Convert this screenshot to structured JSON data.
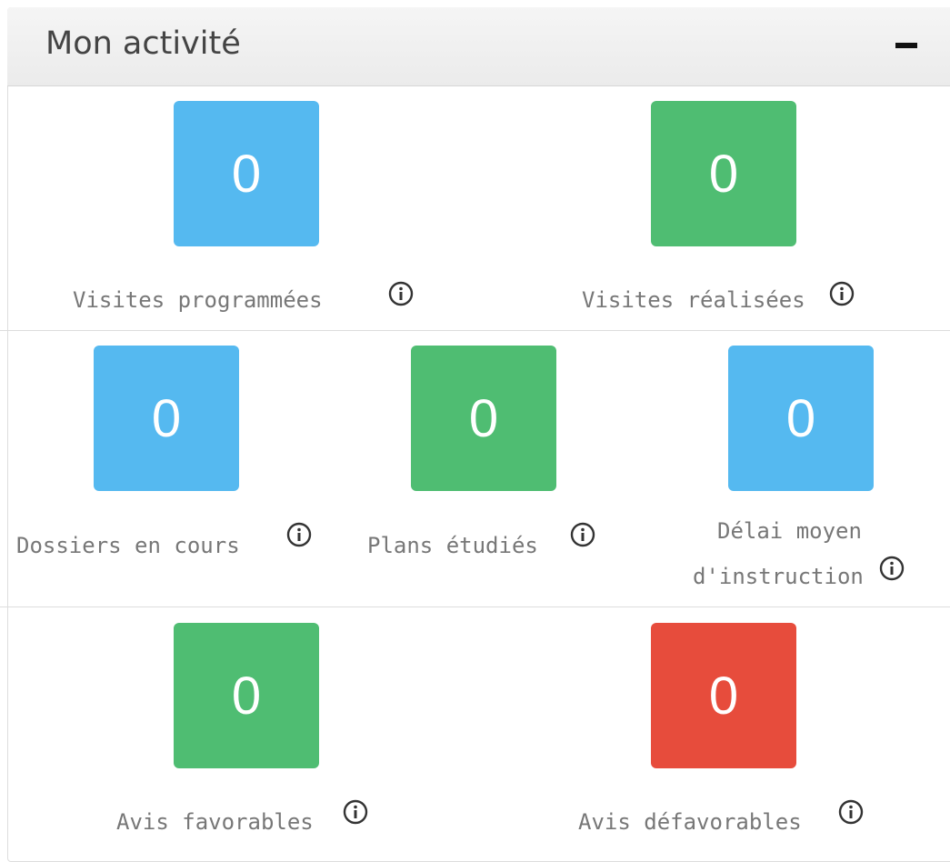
{
  "panel": {
    "title": "Mon activité",
    "collapse_icon": "minus-icon"
  },
  "colors": {
    "blue": "#55b9f0",
    "green": "#4fbd72",
    "red": "#e74c3c",
    "label": "#777777",
    "icon": "#333333"
  },
  "stats": {
    "visites_programmees": {
      "value": "0",
      "label": "Visites programmées",
      "icon": "info-icon"
    },
    "visites_realisees": {
      "value": "0",
      "label": "Visites réalisées",
      "icon": "info-icon"
    },
    "dossiers_en_cours": {
      "value": "0",
      "label": "Dossiers en cours",
      "icon": "info-icon"
    },
    "plans_etudies": {
      "value": "0",
      "label": "Plans étudiés",
      "icon": "info-icon"
    },
    "delai_moyen": {
      "value": "0",
      "label_line1": "Délai moyen",
      "label_line2": "d'instruction",
      "icon": "info-icon"
    },
    "avis_favorables": {
      "value": "0",
      "label": "Avis favorables",
      "icon": "info-icon"
    },
    "avis_defavorables": {
      "value": "0",
      "label": "Avis défavorables",
      "icon": "info-icon"
    }
  }
}
